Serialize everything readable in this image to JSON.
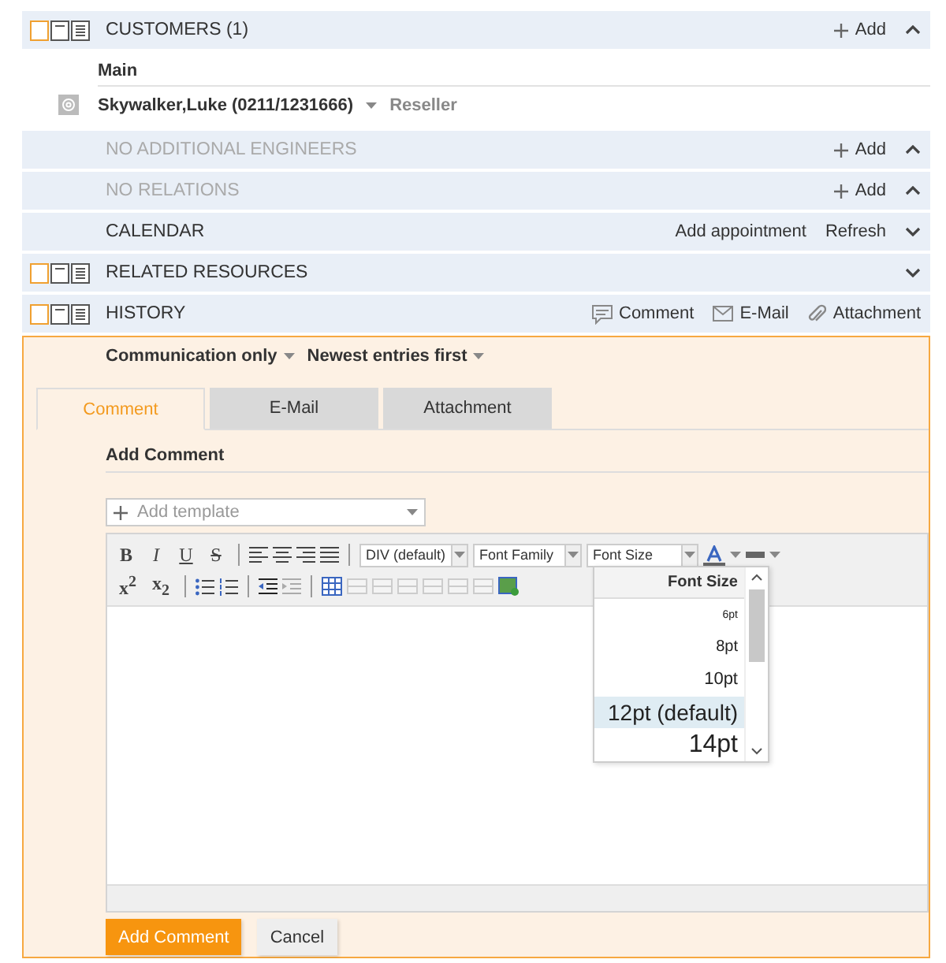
{
  "sections": [
    {
      "title": "CUSTOMERS (1)",
      "muted": false,
      "views": [
        {
          "selected": true
        },
        {
          "selected": false
        },
        {
          "selected": false
        }
      ],
      "actions": [
        {
          "kind": "add",
          "label": "Add"
        }
      ],
      "expanded": true,
      "content": {
        "group": "Main",
        "contacts": [
          {
            "name": "Skywalker,Luke (0211/1231666)",
            "role": "Reseller"
          }
        ]
      }
    },
    {
      "title": "NO ADDITIONAL ENGINEERS",
      "muted": true,
      "actions": [
        {
          "kind": "add",
          "label": "Add"
        }
      ],
      "expanded": true
    },
    {
      "title": "NO RELATIONS",
      "muted": true,
      "actions": [
        {
          "kind": "add",
          "label": "Add"
        }
      ],
      "expanded": true
    },
    {
      "title": "CALENDAR",
      "muted": false,
      "actions": [
        {
          "kind": "text",
          "label": "Add appointment"
        },
        {
          "kind": "text",
          "label": "Refresh"
        }
      ],
      "expanded": false
    },
    {
      "title": "RELATED RESOURCES",
      "muted": false,
      "views": [
        {
          "selected": true
        },
        {
          "selected": false
        },
        {
          "selected": false
        }
      ],
      "expanded": false
    },
    {
      "title": "HISTORY",
      "muted": false,
      "views": [
        {
          "selected": true
        },
        {
          "selected": false
        },
        {
          "selected": false
        }
      ],
      "actions": [
        {
          "kind": "comment",
          "label": "Comment"
        },
        {
          "kind": "mail",
          "label": "E-Mail"
        },
        {
          "kind": "attachment",
          "label": "Attachment"
        }
      ]
    }
  ],
  "history": {
    "filters": [
      "Communication only",
      "Newest entries first"
    ],
    "tabs": [
      {
        "label": "Comment",
        "selected": true
      },
      {
        "label": "E-Mail",
        "selected": false
      },
      {
        "label": "Attachment",
        "selected": false
      }
    ],
    "form_title": "Add Comment",
    "template": {
      "placeholder": "Add template"
    },
    "editor": {
      "format_buttons": [
        "B",
        "I",
        "U",
        "S"
      ],
      "script_buttons": [
        "x$^{2}$",
        "x$_{2}$"
      ],
      "format_select": "DIV (default)",
      "font_family_select": "Font Family",
      "font_size_select": "Font Size",
      "font_size_menu": {
        "title": "Font Size",
        "options": [
          {
            "label": "6pt",
            "selected": false
          },
          {
            "label": "8pt",
            "selected": false
          },
          {
            "label": "10pt",
            "selected": false
          },
          {
            "label": "12pt (default)",
            "selected": true
          },
          {
            "label": "14pt",
            "selected": false
          }
        ]
      }
    },
    "buttons": [
      {
        "kind": "primary",
        "label": "Add Comment"
      },
      {
        "kind": "secondary",
        "label": "Cancel"
      }
    ]
  }
}
